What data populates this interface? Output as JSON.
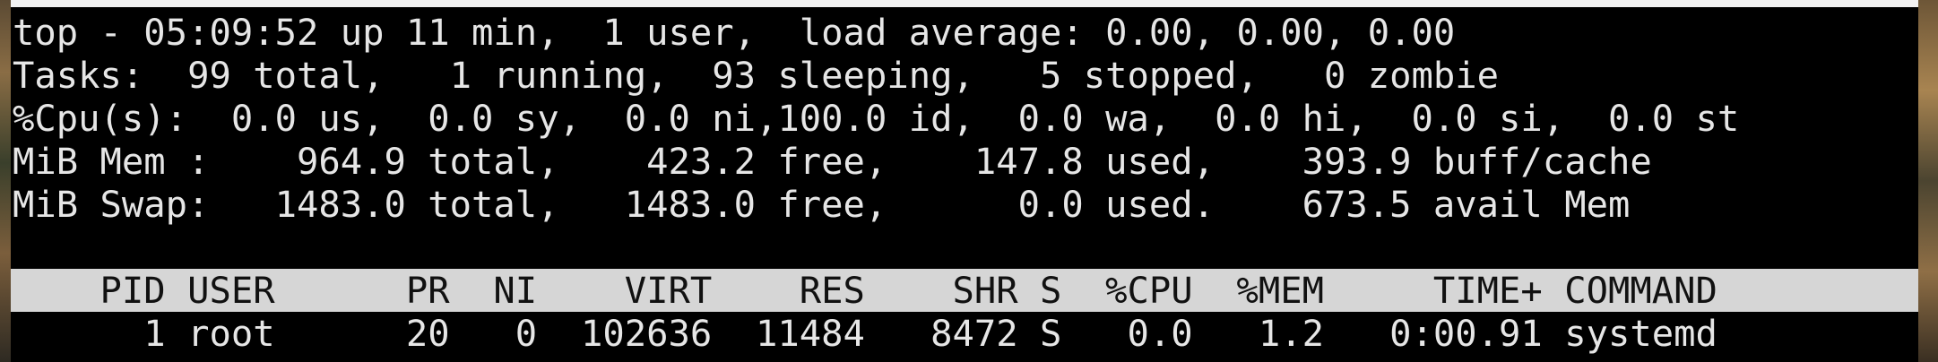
{
  "summary": {
    "uptime_line": "top - 05:09:52 up 11 min,  1 user,  load average: 0.00, 0.00, 0.00",
    "tasks_line": "Tasks:  99 total,   1 running,  93 sleeping,   5 stopped,   0 zombie",
    "cpu_line": "%Cpu(s):  0.0 us,  0.0 sy,  0.0 ni,100.0 id,  0.0 wa,  0.0 hi,  0.0 si,  0.0 st",
    "mem_line": "MiB Mem :    964.9 total,    423.2 free,    147.8 used,    393.9 buff/cache",
    "swap_line": "MiB Swap:   1483.0 total,   1483.0 free,      0.0 used.    673.5 avail Mem"
  },
  "process_table": {
    "header_line": "    PID USER      PR  NI    VIRT    RES    SHR S  %CPU  %MEM     TIME+ COMMAND",
    "rows": [
      {
        "line": "      1 root      20   0  102636  11484   8472 S   0.0   1.2   0:00.91 systemd"
      }
    ]
  },
  "colors": {
    "background": "#000000",
    "foreground": "#e6e6e6",
    "header_bar": "#d6d6d6",
    "header_text": "#111111"
  }
}
